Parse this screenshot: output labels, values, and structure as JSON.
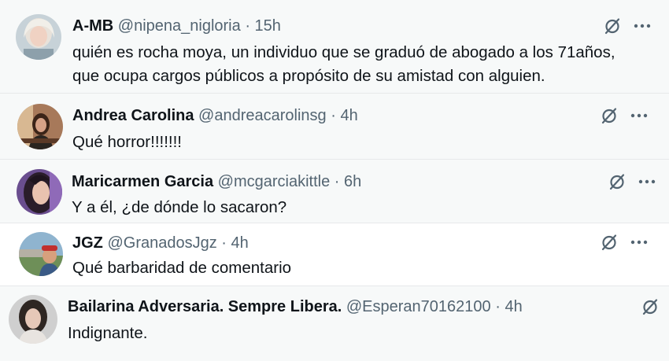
{
  "tweets": [
    {
      "name": "A-MB",
      "handle": "@nipena_nigloria",
      "dot": "·",
      "time": "15h",
      "lines": [
        "quién es rocha moya, un individuo que se graduó de abogado a los 71años,",
        "que ocupa cargos públicos a propósito de su amistad con alguien."
      ]
    },
    {
      "name": "Andrea Carolina",
      "handle": "@andreacarolinsg",
      "dot": "·",
      "time": "4h",
      "lines": [
        "Qué horror!!!!!!!"
      ]
    },
    {
      "name": "Maricarmen Garcia",
      "handle": "@mcgarciakittle",
      "dot": "·",
      "time": "6h",
      "lines": [
        "Y a él, ¿de dónde lo sacaron?"
      ]
    },
    {
      "name": "JGZ",
      "handle": "@GranadosJgz",
      "dot": "·",
      "time": "4h",
      "lines": [
        "Qué barbaridad de comentario"
      ]
    },
    {
      "name": "Bailarina Adversaria. Sempre Libera.",
      "handle": "@Esperan70162100",
      "dot": "·",
      "time": "4h",
      "lines": [
        "Indignante."
      ]
    }
  ],
  "icons": {
    "grok": "grok-slash-circle-icon",
    "more": "more-horizontal-icon"
  },
  "colors": {
    "name": "#0f1419",
    "secondary": "#536471",
    "row_alt_background": "#f7f9f9"
  }
}
